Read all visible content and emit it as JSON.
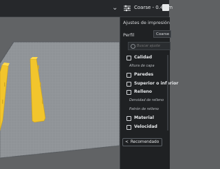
{
  "topbar": {
    "chevron": "⌄",
    "profile_icon": "sliders-icon",
    "profile_label": "Coarse - 0.4mm",
    "close_icon": "close-icon"
  },
  "panel": {
    "title": "Ajustes de impresión",
    "perfil_label": "Perfil",
    "perfil_value": "Coarse - 0.4mm",
    "search_placeholder": "Buscar ajuste",
    "items": [
      {
        "label": "Calidad",
        "icon": "quality-icon"
      },
      {
        "label": "Paredes",
        "icon": "walls-icon"
      },
      {
        "label": "Superior o inferior",
        "icon": "top-bottom-icon"
      },
      {
        "label": "Relleno",
        "icon": "infill-icon"
      },
      {
        "label": "Material",
        "icon": "material-icon"
      },
      {
        "label": "Velocidad",
        "icon": "speed-icon"
      }
    ],
    "sub_items": {
      "layer_height": "Altura de capa",
      "infill_density": "Densidad de relleno",
      "infill_pattern": "Patrón de relleno"
    },
    "recommended_button": "Recomendado",
    "recommended_chevron": "<"
  },
  "colors": {
    "accent": "#ffd94a",
    "bed": "#8c9095",
    "panel_bg": "#1f2123"
  }
}
